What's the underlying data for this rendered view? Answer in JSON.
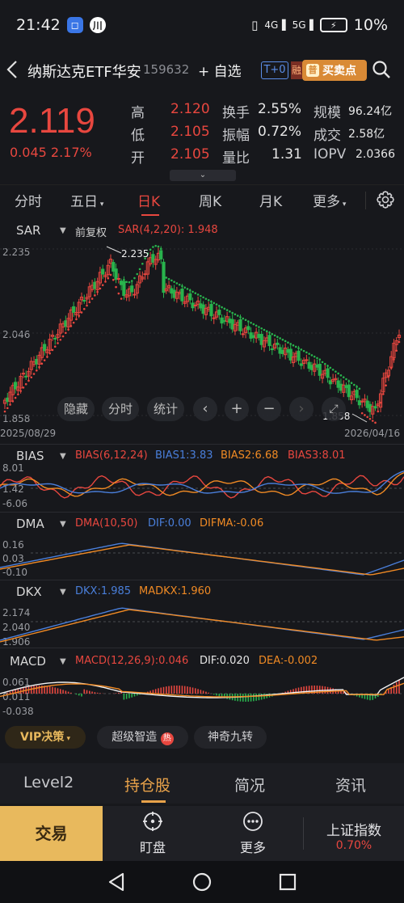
{
  "status_bar": {
    "time": "21:42",
    "network": "4G",
    "network2": "5G",
    "battery": "10%"
  },
  "header": {
    "title": "纳斯达克ETF华安",
    "code": "159632",
    "add_watch": "+ 自选",
    "t0_badge": "T+0",
    "rong_badge": "融",
    "buy_sell_label": "买卖点",
    "buy_sell_icon": "普"
  },
  "quote": {
    "price": "2.119",
    "change": "0.045 2.17%",
    "rows": [
      {
        "l1": "高",
        "v1": "2.120",
        "l2": "换手",
        "v2": "2.55%",
        "l3": "规模",
        "v3": "96.24亿"
      },
      {
        "l1": "低",
        "v1": "2.105",
        "l2": "振幅",
        "v2": "0.72%",
        "l3": "成交",
        "v3": "2.58亿"
      },
      {
        "l1": "开",
        "v1": "2.105",
        "l2": "量比",
        "v2": "1.31",
        "l3": "IOPV",
        "v3": "2.0366"
      }
    ]
  },
  "period_tabs": [
    "分时",
    "五日",
    "日K",
    "周K",
    "月K",
    "更多"
  ],
  "period_active": "日K",
  "main_chart": {
    "indicator": "SAR",
    "adjust": "前复权",
    "sar_label": "SAR(4,2,20): 1.948",
    "y_ticks": [
      "2.235",
      "2.046",
      "1.858"
    ],
    "high_label": "2.235",
    "low_label": "1.858",
    "date_start": "2025/08/29",
    "date_end": "2026/04/16",
    "controls": {
      "hide": "隐藏",
      "intraday": "分时",
      "stats": "统计"
    }
  },
  "bias": {
    "name": "BIAS",
    "params": "BIAS(6,12,24)",
    "b1": "BIAS1:3.83",
    "b2": "BIAS2:6.68",
    "b3": "BIAS3:8.01",
    "ticks": [
      "8.01",
      "1.42",
      "-6.06"
    ]
  },
  "dma": {
    "name": "DMA",
    "params": "DMA(10,50)",
    "dif": "DIF:0.00",
    "difma": "DIFMA:-0.06",
    "ticks": [
      "0.16",
      "0.03",
      "-0.10"
    ]
  },
  "dkx": {
    "name": "DKX",
    "dkx": "DKX:1.985",
    "madkx": "MADKX:1.960",
    "ticks": [
      "2.174",
      "2.040",
      "1.906"
    ]
  },
  "macd": {
    "name": "MACD",
    "params": "MACD(12,26,9):0.046",
    "dif": "DIF:0.020",
    "dea": "DEA:-0.002",
    "ticks": [
      "0.061",
      "0.011",
      "-0.038"
    ]
  },
  "vip_row": {
    "vip": "VIP决策",
    "pill1": "超级智造",
    "pill1_badge": "热",
    "pill2": "神奇九转"
  },
  "info_tabs": [
    "Level2",
    "持仓股",
    "简况",
    "资讯"
  ],
  "info_active": "持仓股",
  "trade_bar": {
    "trade": "交易",
    "watch": "盯盘",
    "more": "更多",
    "index_name": "上证指数",
    "index_change": "0.70%"
  },
  "colors": {
    "up": "#e8473f",
    "down": "#29b34d",
    "accent": "#e8a24a",
    "blue": "#4a7fdb",
    "orange": "#f08a24"
  }
}
